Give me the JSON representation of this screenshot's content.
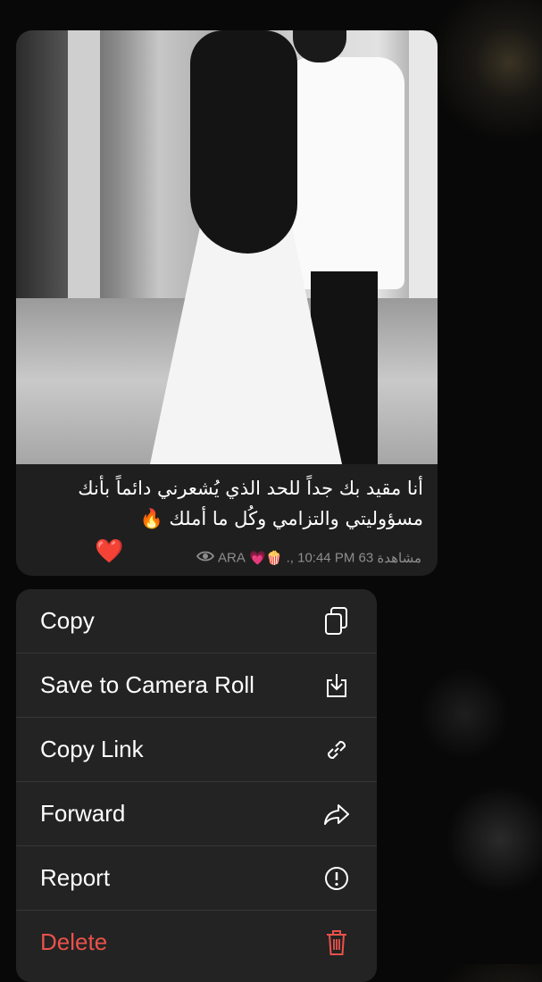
{
  "message": {
    "caption": "أنا مقيد بك جداً للحد الذي يُشعرني دائماً بأنك مسؤوليتي والتزامي وكُل ما أملك 🔥",
    "reaction_emoji": "❤️",
    "meta": {
      "views": "63",
      "views_suffix": "مشاهدة",
      "time": "10:44 PM",
      "sender": "ARA",
      "emojis": "💗🍿",
      "separator": ".,"
    }
  },
  "menu": {
    "items": [
      {
        "label": "Copy",
        "icon": "copy-icon"
      },
      {
        "label": "Save to Camera Roll",
        "icon": "save-download-icon"
      },
      {
        "label": "Copy Link",
        "icon": "link-icon"
      },
      {
        "label": "Forward",
        "icon": "forward-arrow-icon"
      },
      {
        "label": "Report",
        "icon": "report-exclamation-icon"
      },
      {
        "label": "Delete",
        "icon": "trash-icon",
        "color": "#e9524a"
      }
    ]
  }
}
